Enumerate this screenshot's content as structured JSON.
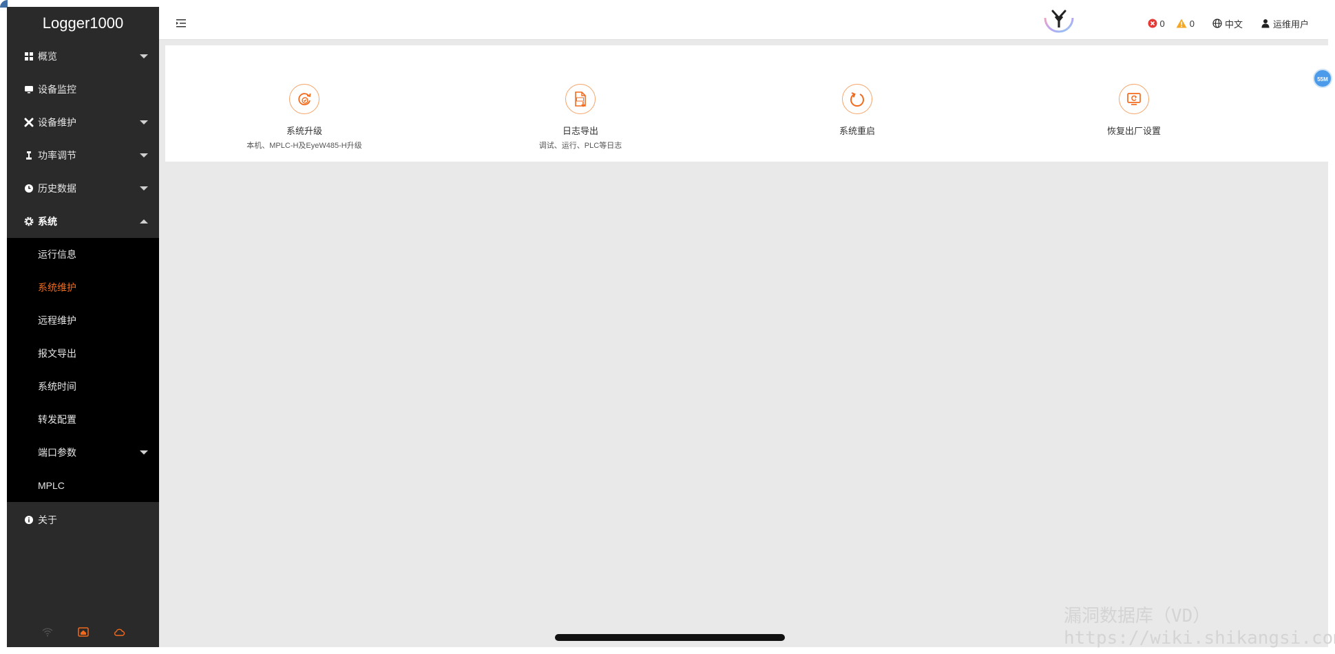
{
  "sidebar": {
    "logo": "Logger1000",
    "items": [
      {
        "label": "概览",
        "icon": "grid-icon",
        "expandable": true
      },
      {
        "label": "设备监控",
        "icon": "monitor-icon",
        "expandable": false
      },
      {
        "label": "设备维护",
        "icon": "tools-icon",
        "expandable": true
      },
      {
        "label": "功率调节",
        "icon": "adjust-icon",
        "expandable": true
      },
      {
        "label": "历史数据",
        "icon": "clock-icon",
        "expandable": true
      },
      {
        "label": "系统",
        "icon": "gear-icon",
        "expandable": true,
        "expanded": true
      }
    ],
    "system_submenu": [
      {
        "label": "运行信息"
      },
      {
        "label": "系统维护",
        "active": true
      },
      {
        "label": "远程维护"
      },
      {
        "label": "报文导出"
      },
      {
        "label": "系统时间"
      },
      {
        "label": "转发配置"
      },
      {
        "label": "端口参数",
        "expandable": true
      },
      {
        "label": "MPLC"
      }
    ],
    "about": {
      "label": "关于",
      "icon": "info-icon"
    },
    "footer_icons": [
      "wifi-icon",
      "home-icon",
      "cloud-icon"
    ]
  },
  "header": {
    "error_count": "0",
    "warning_count": "0",
    "language": "中文",
    "user": "运维用户"
  },
  "tiles": [
    {
      "label": "系统升级",
      "desc": "本机、MPLC-H及EyeW485-H升级",
      "icon": "upgrade-icon"
    },
    {
      "label": "日志导出",
      "desc": "调试、运行、PLC等日志",
      "icon": "log-export-icon"
    },
    {
      "label": "系统重启",
      "desc": "",
      "icon": "restart-icon"
    },
    {
      "label": "恢复出厂设置",
      "desc": "",
      "icon": "factory-reset-icon"
    }
  ],
  "float_badge": "55M",
  "watermark": {
    "line1": "漏洞数据库（VD）",
    "line2": "https://wiki.shikangsi.com"
  },
  "colors": {
    "accent": "#f26a1b",
    "sidebar_bg": "#2a2a2a",
    "submenu_bg": "#000000",
    "content_bg": "#e9e9e9"
  }
}
